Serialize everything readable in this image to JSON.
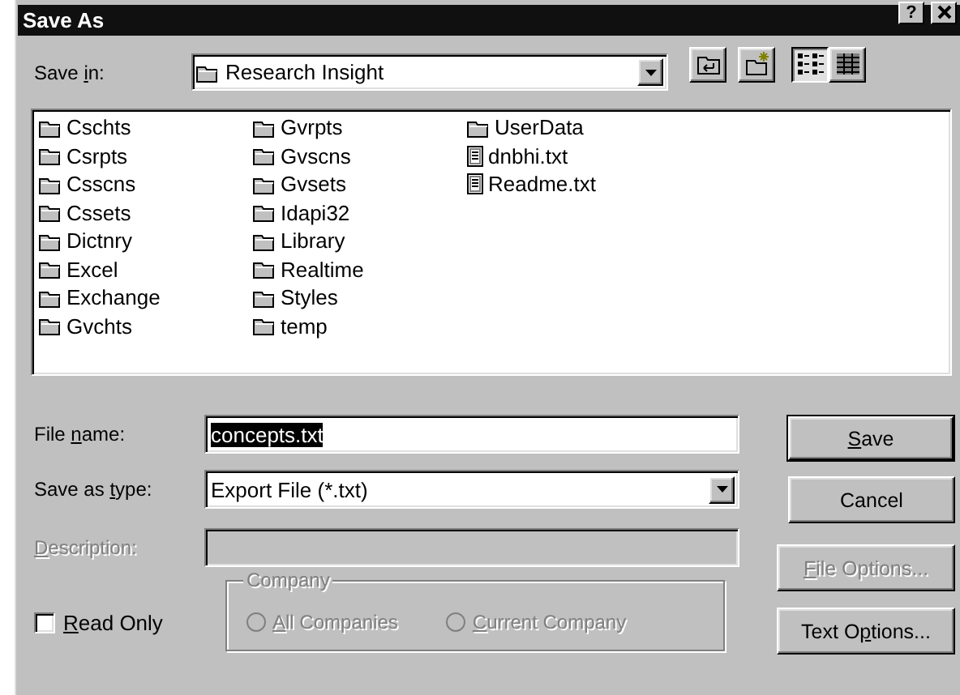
{
  "window": {
    "title": "Save As",
    "help_button": "?"
  },
  "save_in": {
    "label": {
      "before": "Save ",
      "key": "i",
      "after": "n:"
    },
    "value": "Research Insight"
  },
  "toolbar": [
    {
      "kind": "up-folder"
    },
    {
      "kind": "new-folder"
    }
  ],
  "view_buttons": [
    {
      "kind": "list",
      "selected": true
    },
    {
      "kind": "details",
      "selected": false
    }
  ],
  "files": [
    {
      "name": "Cschts",
      "kind": "folder"
    },
    {
      "name": "Csrpts",
      "kind": "folder"
    },
    {
      "name": "Csscns",
      "kind": "folder"
    },
    {
      "name": "Cssets",
      "kind": "folder"
    },
    {
      "name": "Dictnry",
      "kind": "folder"
    },
    {
      "name": "Excel",
      "kind": "folder"
    },
    {
      "name": "Exchange",
      "kind": "folder"
    },
    {
      "name": "Gvchts",
      "kind": "folder"
    },
    {
      "name": "Gvrpts",
      "kind": "folder"
    },
    {
      "name": "Gvscns",
      "kind": "folder"
    },
    {
      "name": "Gvsets",
      "kind": "folder"
    },
    {
      "name": "Idapi32",
      "kind": "folder"
    },
    {
      "name": "Library",
      "kind": "folder"
    },
    {
      "name": "Realtime",
      "kind": "folder"
    },
    {
      "name": "Styles",
      "kind": "folder"
    },
    {
      "name": "temp",
      "kind": "folder"
    },
    {
      "name": "UserData",
      "kind": "folder"
    },
    {
      "name": "dnbhi.txt",
      "kind": "text"
    },
    {
      "name": "Readme.txt",
      "kind": "text"
    }
  ],
  "file_name": {
    "label": {
      "before": "File ",
      "key": "n",
      "after": "ame:"
    },
    "value": "concepts.txt",
    "text_selected": true
  },
  "save_as_type": {
    "label": {
      "before": "Save as ",
      "key": "t",
      "after": "ype:"
    },
    "value": "Export File (*.txt)"
  },
  "description": {
    "label": {
      "key": "D",
      "after": "escription:"
    },
    "disabled": true
  },
  "read_only": {
    "label": {
      "key": "R",
      "after": "ead Only"
    },
    "checked": false
  },
  "company": {
    "legend": "Company",
    "disabled": true,
    "options": [
      {
        "label": {
          "key": "A",
          "after": "ll Companies"
        },
        "selected": false
      },
      {
        "label": {
          "key": "C",
          "after": "urrent Company"
        },
        "selected": false
      }
    ]
  },
  "buttons": [
    {
      "label": {
        "key": "S",
        "after": "ave"
      },
      "default": true,
      "disabled": false
    },
    {
      "label": {
        "before": "Cancel"
      },
      "default": false,
      "disabled": false
    },
    {
      "label": {
        "key": "F",
        "after": "ile Options..."
      },
      "default": false,
      "disabled": true
    },
    {
      "label": {
        "before": "Text O",
        "key": "p",
        "after": "tions..."
      },
      "default": false,
      "disabled": false
    }
  ]
}
